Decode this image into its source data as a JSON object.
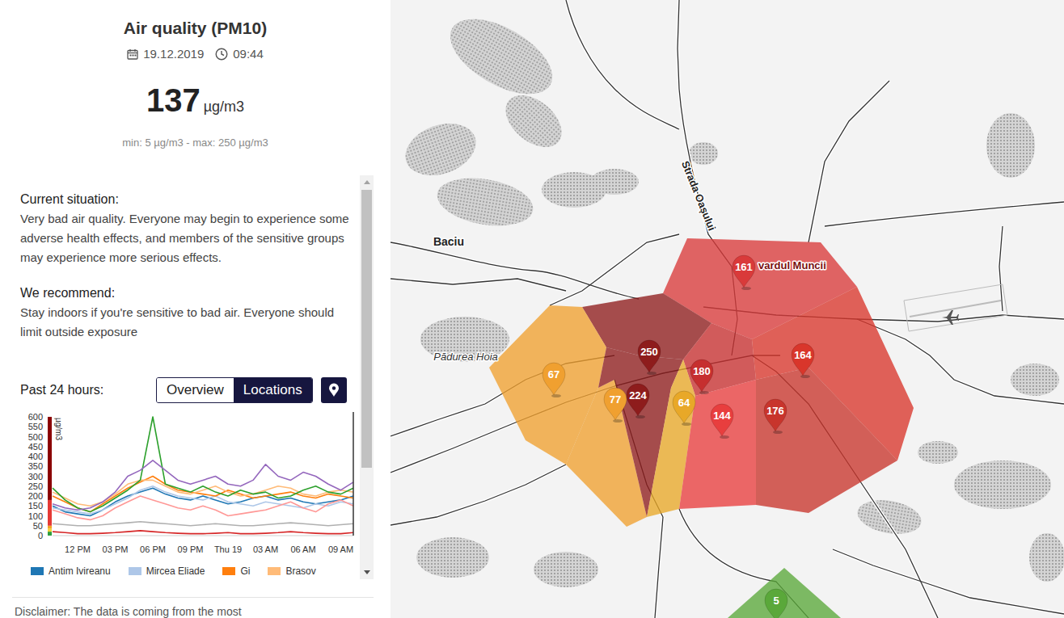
{
  "header": {
    "title": "Air quality (PM10)",
    "date": "19.12.2019",
    "time": "09:44",
    "value": "137",
    "unit": "µg/m3",
    "range": "min: 5 µg/m3 - max: 250 µg/m3"
  },
  "situation": {
    "label": "Current situation:",
    "text": "Very bad air quality. Everyone may begin to experience some adverse health effects, and members of the sensitive groups may experience more serious effects."
  },
  "recommendation": {
    "label": "We recommend:",
    "text": "Stay indoors if you're sensitive to bad air. Everyone should limit outside exposure"
  },
  "chart": {
    "label": "Past 24 hours:",
    "tabs": [
      {
        "label": "Overview",
        "selected": false
      },
      {
        "label": "Locations",
        "selected": true
      }
    ],
    "unit": "µg/m3",
    "y_ticks": [
      "600",
      "550",
      "500",
      "450",
      "400",
      "350",
      "300",
      "250",
      "200",
      "150",
      "100",
      "50",
      "0"
    ],
    "x_ticks": [
      "12 PM",
      "03 PM",
      "06 PM",
      "09 PM",
      "Thu 19",
      "03 AM",
      "06 AM",
      "09 AM"
    ],
    "scale": [
      {
        "from": 0,
        "to": 20,
        "color": "#2e9e3f"
      },
      {
        "from": 20,
        "to": 35,
        "color": "#f2d23a"
      },
      {
        "from": 35,
        "to": 50,
        "color": "#f5a623"
      },
      {
        "from": 50,
        "to": 180,
        "color": "#e53935"
      },
      {
        "from": 180,
        "to": 600,
        "color": "#8b0000"
      }
    ],
    "series": [
      {
        "name": "Antim Ivireanu",
        "color": "#1f77b4",
        "values": [
          150,
          120,
          110,
          100,
          130,
          170,
          200,
          220,
          240,
          210,
          190,
          180,
          200,
          180,
          160,
          170,
          190,
          200,
          180,
          190,
          170,
          160,
          170,
          180,
          200
        ]
      },
      {
        "name": "Mircea Eliade",
        "color": "#aec7e8",
        "values": [
          140,
          130,
          120,
          110,
          130,
          160,
          190,
          230,
          250,
          220,
          200,
          190,
          180,
          200,
          170,
          160,
          150,
          170,
          160,
          150,
          140,
          160,
          150,
          170,
          160
        ]
      },
      {
        "name": "Gi",
        "color": "#ff7f0e",
        "values": [
          200,
          170,
          140,
          120,
          160,
          200,
          240,
          270,
          300,
          260,
          230,
          220,
          210,
          200,
          230,
          210,
          190,
          200,
          210,
          220,
          200,
          190,
          210,
          200,
          190
        ]
      },
      {
        "name": "Brasov",
        "color": "#ffbb78",
        "values": [
          220,
          190,
          160,
          150,
          170,
          210,
          260,
          280,
          280,
          250,
          220,
          210,
          230,
          250,
          220,
          200,
          210,
          230,
          250,
          240,
          210,
          200,
          220,
          230,
          220
        ]
      },
      {
        "color": "#2ca02c",
        "values": [
          240,
          180,
          140,
          120,
          150,
          190,
          230,
          280,
          600,
          260,
          240,
          220,
          250,
          220,
          200,
          230,
          210,
          220,
          190,
          200,
          230,
          250,
          220,
          210,
          240
        ]
      },
      {
        "color": "#9467bd",
        "values": [
          160,
          140,
          130,
          140,
          170,
          220,
          300,
          330,
          380,
          330,
          280,
          260,
          280,
          300,
          260,
          250,
          280,
          360,
          300,
          280,
          320,
          300,
          260,
          230,
          270
        ]
      },
      {
        "color": "#ff9896",
        "values": [
          130,
          110,
          90,
          80,
          100,
          140,
          170,
          200,
          180,
          160,
          140,
          130,
          150,
          130,
          100,
          110,
          120,
          130,
          150,
          170,
          140,
          120,
          160,
          180,
          150
        ]
      },
      {
        "color": "#d62728",
        "values": [
          20,
          15,
          10,
          10,
          12,
          15,
          20,
          25,
          20,
          15,
          12,
          10,
          10,
          12,
          15,
          10,
          10,
          12,
          15,
          20,
          15,
          12,
          10,
          10,
          15
        ]
      },
      {
        "color": "#b0b0b0",
        "values": [
          60,
          55,
          50,
          50,
          55,
          60,
          65,
          70,
          65,
          60,
          55,
          50,
          55,
          60,
          55,
          50,
          50,
          55,
          60,
          65,
          60,
          55,
          50,
          55,
          60
        ]
      }
    ]
  },
  "disclaimer": "Disclaimer: The data is coming from the most",
  "map": {
    "labels": [
      "Baciu",
      "Pădurea Hoia",
      "Strada Oașului",
      "vardul Muncii"
    ],
    "stations": [
      {
        "value": "161",
        "color": "#d93a3a"
      },
      {
        "value": "250",
        "color": "#8e1c1c"
      },
      {
        "value": "180",
        "color": "#c62f2f"
      },
      {
        "value": "164",
        "color": "#d9362b"
      },
      {
        "value": "67",
        "color": "#f0a030"
      },
      {
        "value": "77",
        "color": "#f0a030"
      },
      {
        "value": "224",
        "color": "#8e1c1c"
      },
      {
        "value": "64",
        "color": "#e8a828"
      },
      {
        "value": "144",
        "color": "#e83e3e"
      },
      {
        "value": "176",
        "color": "#c8352c"
      },
      {
        "value": "5",
        "color": "#5aa83a"
      }
    ]
  }
}
